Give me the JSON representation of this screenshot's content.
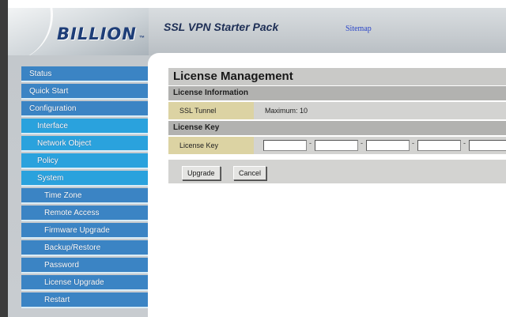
{
  "header": {
    "logo_text": "BILLION",
    "logo_tm": "™",
    "app_title": "SSL VPN Starter Pack",
    "sitemap_link": "Sitemap"
  },
  "sidebar": {
    "items": [
      {
        "label": "Status",
        "level": 1
      },
      {
        "label": "Quick Start",
        "level": 1
      },
      {
        "label": "Configuration",
        "level": 1
      },
      {
        "label": "Interface",
        "level": 2
      },
      {
        "label": "Network Object",
        "level": 2
      },
      {
        "label": "Policy",
        "level": 2
      },
      {
        "label": "System",
        "level": 2
      },
      {
        "label": "Time Zone",
        "level": 3
      },
      {
        "label": "Remote Access",
        "level": 3
      },
      {
        "label": "Firmware Upgrade",
        "level": 3
      },
      {
        "label": "Backup/Restore",
        "level": 3
      },
      {
        "label": "Password",
        "level": 3
      },
      {
        "label": "License Upgrade",
        "level": 3
      },
      {
        "label": "Restart",
        "level": 3
      }
    ]
  },
  "main": {
    "title": "License Management",
    "license_info": {
      "section_label": "License Information",
      "ssl_tunnel_label": "SSL Tunnel",
      "ssl_tunnel_value": "Maximum: 10"
    },
    "license_key": {
      "section_label": "License Key",
      "field_label": "License Key",
      "values": [
        "",
        "",
        "",
        "",
        ""
      ],
      "separator": "-"
    },
    "buttons": {
      "upgrade_label": "Upgrade",
      "cancel_label": "Cancel"
    }
  },
  "colors": {
    "nav_primary": "#3b84c4",
    "nav_secondary": "#2aa2dd",
    "label_cell": "#dcd3a3",
    "brand": "#1e3e78"
  }
}
